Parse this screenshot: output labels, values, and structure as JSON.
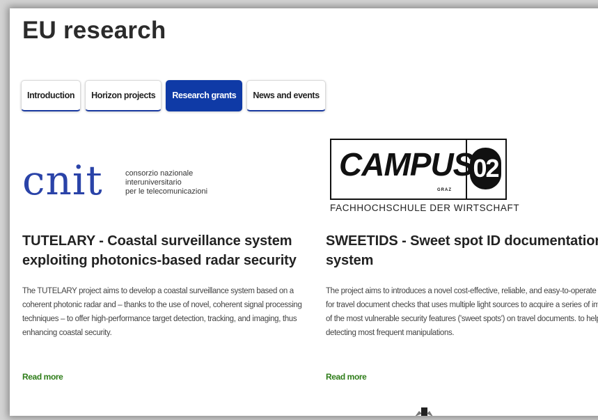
{
  "page": {
    "title": "EU research"
  },
  "tabs": [
    {
      "label": "Introduction",
      "active": false
    },
    {
      "label": "Horizon projects",
      "active": false
    },
    {
      "label": "Research grants",
      "active": true
    },
    {
      "label": "News and events",
      "active": false
    }
  ],
  "cards": [
    {
      "logo": {
        "letters": "cnit",
        "lines": [
          "consorzio nazionale",
          "interuniversitario",
          "per le telecomunicazioni"
        ]
      },
      "title": "TUTELARY - Coastal surveillance system exploiting photonics-based radar security",
      "description": "The TUTELARY project aims to develop a coastal surveillance system based on a coherent photonic radar and – thanks to the use of novel, coherent signal processing techniques – to offer high-performance target detection, tracking, and imaging, thus enhancing coastal security.",
      "read_more": "Read more"
    },
    {
      "logo": {
        "word": "CAMPUS",
        "number": "02",
        "city": "GRAZ",
        "subtitle": "FACHHOCHSCHULE DER WIRTSCHAFT"
      },
      "title": "SWEETIDS - Sweet spot ID documentation system",
      "description_lines": [
        "The project aims to introduces a novel cost-effective, reliable, and easy-to-operate dev",
        "for travel document checks that uses multiple light sources to acquire a series of imag",
        "of the most vulnerable security features ('sweet spots') on travel documents. to help",
        "detecting most frequent manipulations."
      ],
      "read_more": "Read more"
    }
  ],
  "colors": {
    "tab_active": "#0f3aa6",
    "tab_border": "#1a3aa0",
    "link": "#2e7d19",
    "cnit_blue": "#2a43a8"
  }
}
